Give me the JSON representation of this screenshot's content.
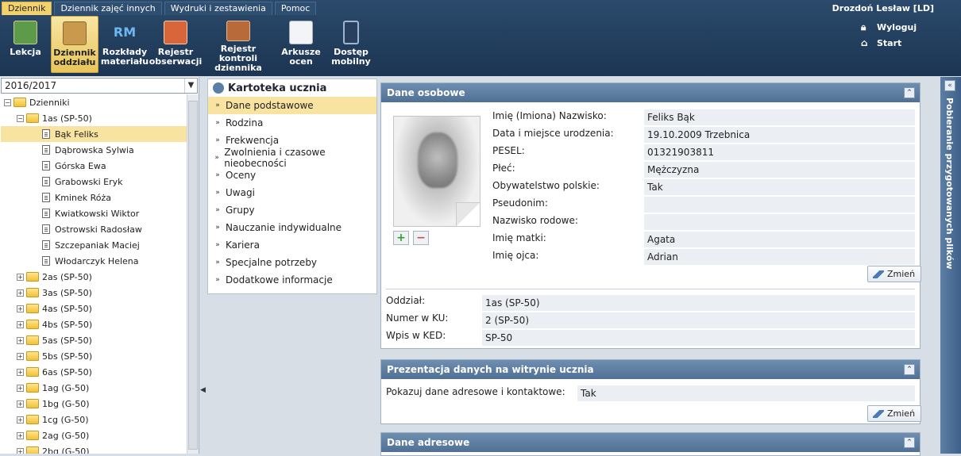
{
  "menu": {
    "tabs": [
      "Dziennik",
      "Dziennik zajęć innych",
      "Wydruki i zestawienia",
      "Pomoc"
    ],
    "active": 0
  },
  "user": {
    "name": "Drozdoń Lesław [LD]",
    "logout": "Wyloguj",
    "start": "Start"
  },
  "toolbar": [
    {
      "label_line1": "Lekcja",
      "label_line2": "",
      "icon": "lesson-icon",
      "icon_text": ""
    },
    {
      "label_line1": "Dziennik",
      "label_line2": "oddziału",
      "icon": "class-journal-icon",
      "icon_text": ""
    },
    {
      "label_line1": "Rozkłady",
      "label_line2": "materiału",
      "icon": "rm-icon",
      "icon_text": "RM"
    },
    {
      "label_line1": "Rejestr",
      "label_line2": "obserwacji",
      "icon": "observation-register-icon",
      "icon_text": ""
    },
    {
      "label_line1": "Rejestr kontroli",
      "label_line2": "dziennika",
      "icon": "control-register-icon",
      "icon_text": ""
    },
    {
      "label_line1": "Arkusze",
      "label_line2": "ocen",
      "icon": "grade-sheets-icon",
      "icon_text": ""
    },
    {
      "label_line1": "Dostęp",
      "label_line2": "mobilny",
      "icon": "mobile-access-icon",
      "icon_text": ""
    }
  ],
  "left": {
    "year": "2016/2017",
    "root": "Dzienniki",
    "open_class": "1as (SP-50)",
    "students": [
      "Bąk Feliks",
      "Dąbrowska Sylwia",
      "Górska Ewa",
      "Grabowski Eryk",
      "Kminek Róża",
      "Kwiatkowski Wiktor",
      "Ostrowski Radosław",
      "Szczepaniak Maciej",
      "Włodarczyk Helena"
    ],
    "selected_student": 0,
    "classes": [
      "2as (SP-50)",
      "3as (SP-50)",
      "4as (SP-50)",
      "4bs (SP-50)",
      "5as (SP-50)",
      "5bs (SP-50)",
      "6as (SP-50)",
      "1ag (G-50)",
      "1bg (G-50)",
      "1cg (G-50)",
      "2ag (G-50)",
      "2bg (G-50)"
    ]
  },
  "middle": {
    "title": "Kartoteka ucznia",
    "items": [
      "Dane podstawowe",
      "Rodzina",
      "Frekwencja",
      "Zwolnienia i czasowe nieobecności",
      "Oceny",
      "Uwagi",
      "Grupy",
      "Nauczanie indywidualne",
      "Kariera",
      "Specjalne potrzeby",
      "Dodatkowe informacje"
    ],
    "active": 0
  },
  "personal": {
    "title": "Dane osobowe",
    "fields": [
      {
        "label": "Imię (Imiona) Nazwisko:",
        "value": "Feliks Bąk"
      },
      {
        "label": "Data i miejsce urodzenia:",
        "value": "19.10.2009 Trzebnica"
      },
      {
        "label": "PESEL:",
        "value": "01321903811"
      },
      {
        "label": "Płeć:",
        "value": "Mężczyzna"
      },
      {
        "label": "Obywatelstwo polskie:",
        "value": "Tak"
      },
      {
        "label": "Pseudonim:",
        "value": ""
      },
      {
        "label": "Nazwisko rodowe:",
        "value": ""
      },
      {
        "label": "Imię matki:",
        "value": "Agata"
      },
      {
        "label": "Imię ojca:",
        "value": "Adrian"
      }
    ],
    "edit_label": "Zmień",
    "class_fields": [
      {
        "label": "Oddział:",
        "value": "1as (SP-50)"
      },
      {
        "label": "Numer w KU:",
        "value": "2 (SP-50)"
      },
      {
        "label": "Wpis w KED:",
        "value": "SP-50"
      }
    ]
  },
  "presentation": {
    "title": "Prezentacja danych na witrynie ucznia",
    "label": "Pokazuj dane adresowe i kontaktowe:",
    "value": "Tak",
    "edit_label": "Zmień"
  },
  "address": {
    "title": "Dane adresowe"
  },
  "right_panel": {
    "label": "Pobieranie przygotowanych plików"
  }
}
